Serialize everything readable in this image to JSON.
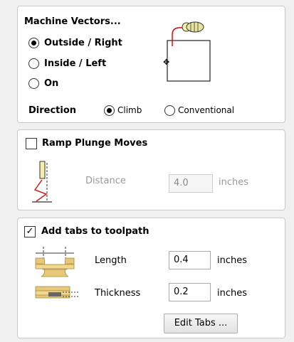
{
  "machine_vectors": {
    "title": "Machine Vectors...",
    "options": [
      "Outside / Right",
      "Inside / Left",
      "On"
    ],
    "selected": "Outside / Right",
    "direction_label": "Direction",
    "direction_options": [
      "Climb",
      "Conventional"
    ],
    "direction_selected": "Climb"
  },
  "ramp": {
    "label": "Ramp Plunge Moves",
    "checked": false,
    "distance_label": "Distance",
    "distance_value": "4.0",
    "distance_unit": "inches"
  },
  "tabs": {
    "label": "Add tabs to toolpath",
    "checked": true,
    "length_label": "Length",
    "length_value": "0.4",
    "length_unit": "inches",
    "thickness_label": "Thickness",
    "thickness_value": "0.2",
    "thickness_unit": "inches",
    "edit_button": "Edit Tabs ..."
  },
  "icons": [
    "vector-offset-diagram-icon",
    "ramp-plunge-icon",
    "tab-length-icon",
    "tab-thickness-icon"
  ]
}
